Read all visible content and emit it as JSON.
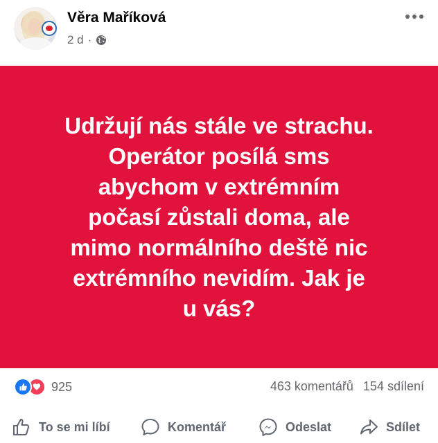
{
  "author": {
    "name": "Věra Maříková",
    "age": "2 d",
    "separator": "·"
  },
  "post": {
    "text": "Udržují nás stále ve strachu.\nOperátor posílá sms\nabychom v  extrémním\npočasí zůstali doma, ale\nmimo normálního deště nic\nextrémního nevidím. Jak je\nu vás?",
    "background_color": "#e1133c"
  },
  "stats": {
    "reactions": "925",
    "comments": "463 komentářů",
    "shares": "154 sdílení"
  },
  "actions": {
    "like": "To se mi líbí",
    "comment": "Komentář",
    "send": "Odeslat",
    "share": "Sdílet"
  }
}
